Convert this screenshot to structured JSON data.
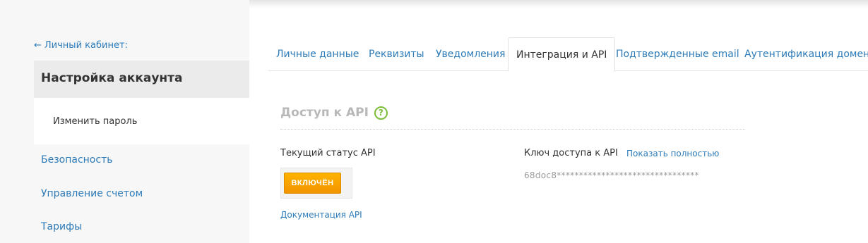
{
  "sidebar": {
    "back_label": "Личный кабинет:",
    "active_title": "Настройка аккаунта",
    "sub_item": "Изменить пароль",
    "items": [
      {
        "label": "Безопасность"
      },
      {
        "label": "Управление счетом"
      },
      {
        "label": "Тарифы"
      }
    ]
  },
  "tabs": [
    {
      "label": "Личные данные"
    },
    {
      "label": "Реквизиты"
    },
    {
      "label": "Уведомления"
    },
    {
      "label": "Интеграция и API"
    },
    {
      "label": "Подтвержденные email"
    },
    {
      "label": "Аутентификация домена"
    }
  ],
  "active_tab": "Интеграция и API",
  "api": {
    "section_title": "Доступ к API",
    "help_glyph": "?",
    "status_label": "Текущий статус API",
    "status_button": "ВКЛЮЧЁН",
    "docs_link": "Документация API",
    "key_label": "Ключ доступа к API",
    "show_full_link": "Показать полностью",
    "key_value": "68doc8********************************"
  },
  "colors": {
    "link": "#2d7bb8",
    "accent_orange": "#f29400",
    "help_green": "#7cbd3a",
    "sidebar_bg": "#f7f7f7"
  },
  "icons": {
    "back": "arrow-left-icon",
    "help": "question-circle-icon"
  }
}
